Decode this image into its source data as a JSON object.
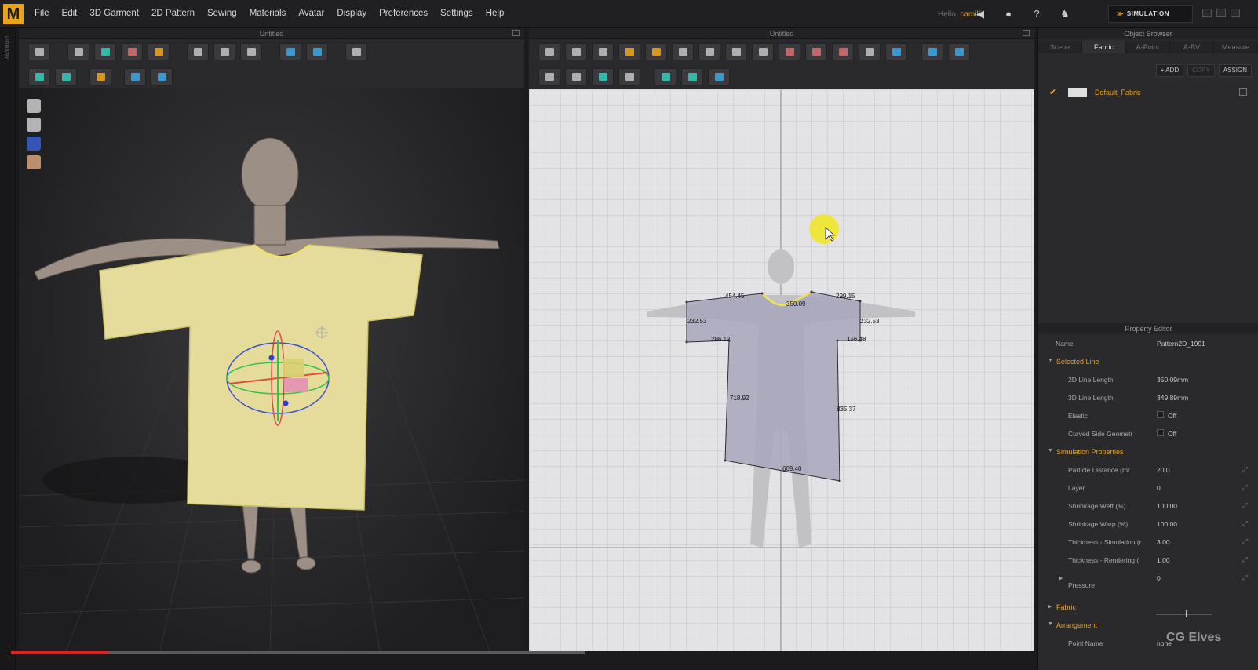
{
  "app": {
    "logo_letter": "M",
    "menu": [
      "File",
      "Edit",
      "3D Garment",
      "2D Pattern",
      "Sewing",
      "Materials",
      "Avatar",
      "Display",
      "Preferences",
      "Settings",
      "Help"
    ],
    "hello_label": "Hello,",
    "user": "camilli",
    "mode_button": "SIMULATION",
    "library_strip": "LIBRARY"
  },
  "viewport3d": {
    "title": "Untitled"
  },
  "viewport2d": {
    "title": "Untitled",
    "measurements": [
      "454.45",
      "350.09",
      "299.15",
      "232.53",
      "232.53",
      "286.12",
      "156.48",
      "718.92",
      "835.37",
      "669.40"
    ]
  },
  "object_browser": {
    "title": "Object Browser",
    "tabs": [
      "Scene",
      "Fabric",
      "A-Point",
      "A-BV",
      "Measure"
    ],
    "active_tab": "Fabric",
    "actions": [
      "+ ADD",
      "COPY",
      "ASSIGN"
    ],
    "fabric_name": "Default_Fabric"
  },
  "property_editor": {
    "title": "Property Editor",
    "name_label": "Name",
    "name_value": "Pattern2D_1991",
    "sections": {
      "selected_line": "Selected Line",
      "simulation_properties": "Simulation Properties",
      "fabric": "Fabric",
      "arrangement": "Arrangement"
    },
    "rows": {
      "line_length_2d": {
        "k": "2D Line Length",
        "v": "350.09mm"
      },
      "line_length_3d": {
        "k": "3D Line Length",
        "v": "349.89mm"
      },
      "elastic": {
        "k": "Elastic",
        "v": "Off"
      },
      "curved_side": {
        "k": "Curved Side Geometr",
        "v": "Off"
      },
      "particle_distance": {
        "k": "Particle Distance (mr",
        "v": "20.0"
      },
      "layer": {
        "k": "Layer",
        "v": "0"
      },
      "shrinkage_weft": {
        "k": "Shrinkage Weft (%)",
        "v": "100.00"
      },
      "shrinkage_warp": {
        "k": "Shrinkage Warp (%)",
        "v": "100.00"
      },
      "thickness_sim": {
        "k": "Thickness - Simulation (r",
        "v": "3.00"
      },
      "thickness_render": {
        "k": "Thickness - Rendering (",
        "v": "1.00"
      },
      "pressure": {
        "k": "Pressure",
        "v": "0"
      },
      "point_name": {
        "k": "Point Name",
        "v": "none"
      }
    }
  },
  "watermark": "CG Elves",
  "video_progress": 0.17,
  "colors": {
    "accent": "#e9a21b",
    "garment_3d": "#e5dc9c",
    "pattern_2d": "#a7a7bb",
    "progress": "#e01f1f"
  }
}
